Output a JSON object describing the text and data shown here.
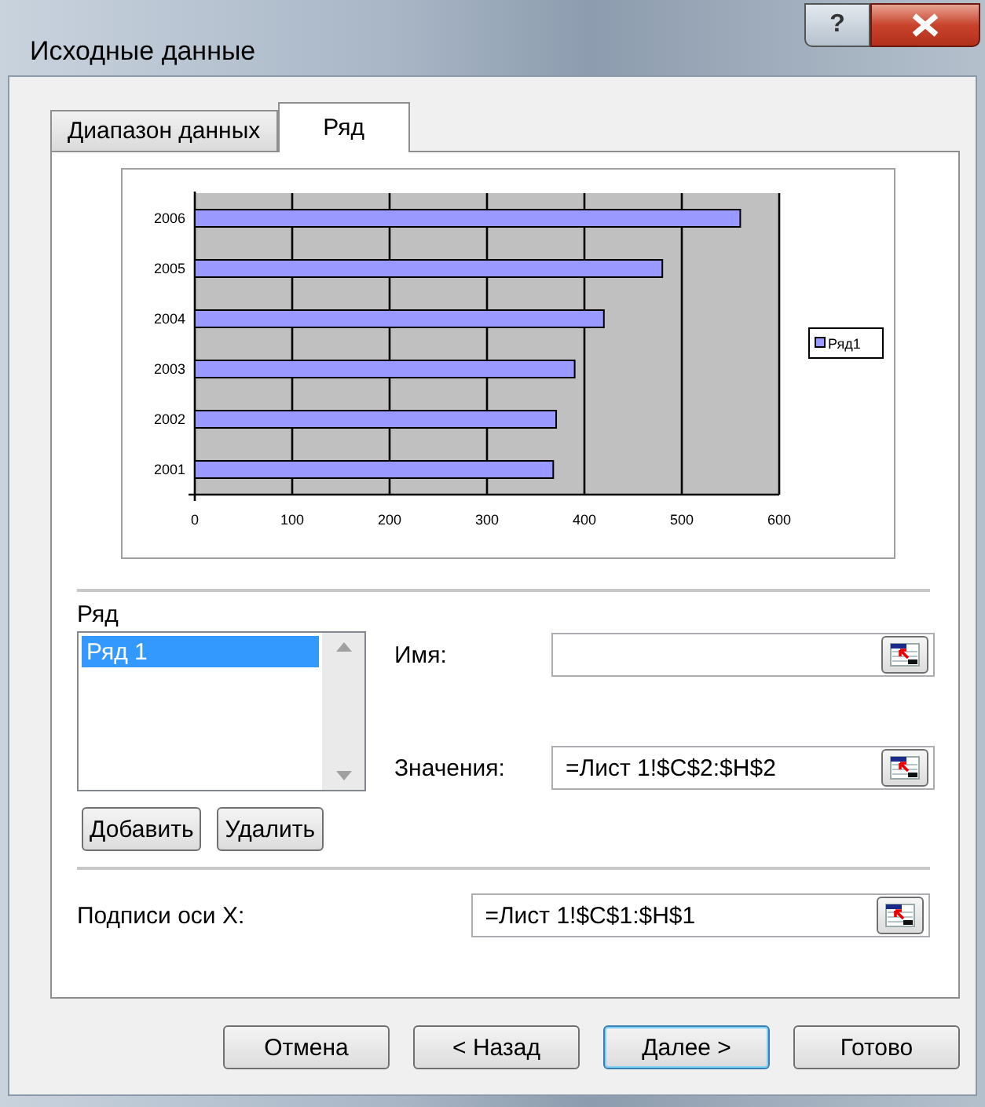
{
  "window": {
    "title": "Исходные данные",
    "help": "?"
  },
  "tabs": [
    {
      "label": "Диапазон данных",
      "selected": false
    },
    {
      "label": "Ряд",
      "selected": true
    }
  ],
  "chart_data": {
    "type": "bar",
    "orientation": "horizontal",
    "grid": true,
    "categories": [
      "2006",
      "2005",
      "2004",
      "2003",
      "2002",
      "2001"
    ],
    "series": [
      {
        "name": "Ряд1",
        "color": "#9999ff",
        "values": [
          560,
          480,
          420,
          390,
          371,
          368
        ]
      }
    ],
    "xlim": [
      0,
      600
    ],
    "xticks": [
      0,
      100,
      200,
      300,
      400,
      500,
      600
    ]
  },
  "series_section": {
    "label": "Ряд",
    "items": [
      {
        "label": "Ряд 1",
        "selected": true
      }
    ],
    "buttons": [
      "Добавить",
      "Удалить"
    ]
  },
  "fields": [
    {
      "label": "Имя:"
    },
    {
      "label": "Значения:",
      "value": "=Лист 1!$C$2:$H$2"
    }
  ],
  "x_labels": {
    "label": "Подписи оси X:",
    "value": "=Лист 1!$C$1:$H$1"
  },
  "footer_buttons": [
    {
      "label": "Отмена",
      "default": false
    },
    {
      "label": "< Назад",
      "default": false
    },
    {
      "label": "Далее >",
      "default": true
    },
    {
      "label": "Готово",
      "default": false
    }
  ]
}
